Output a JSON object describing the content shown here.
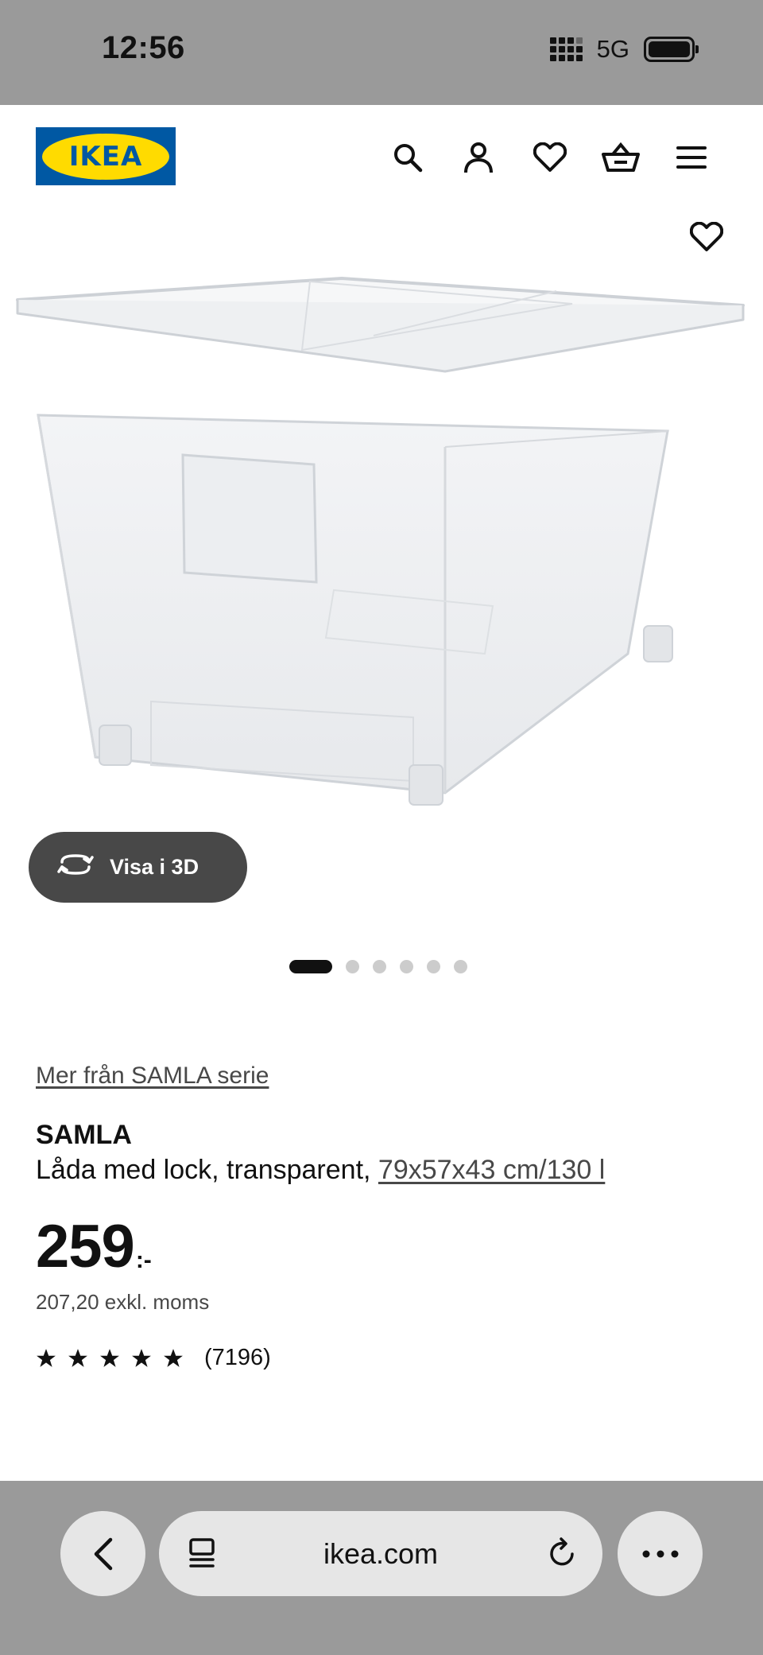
{
  "status_bar": {
    "time": "12:56",
    "network": "5G"
  },
  "header": {
    "logo_text": "IKEA",
    "brand_blue": "#0058a3",
    "brand_yellow": "#ffdb00"
  },
  "gallery": {
    "view_3d_label": "Visa i 3D",
    "page_count": 6,
    "active_index": 0
  },
  "product": {
    "series_link": "Mer från SAMLA serie",
    "name": "SAMLA",
    "description": "Låda med lock, transparent,",
    "dimensions": "79x57x43 cm/130 l",
    "price": "259",
    "price_suffix": ":-",
    "price_ex_vat": "207,20 exkl. moms",
    "rating_stars": 5,
    "rating_count": "(7196)"
  },
  "browser": {
    "url": "ikea.com"
  }
}
